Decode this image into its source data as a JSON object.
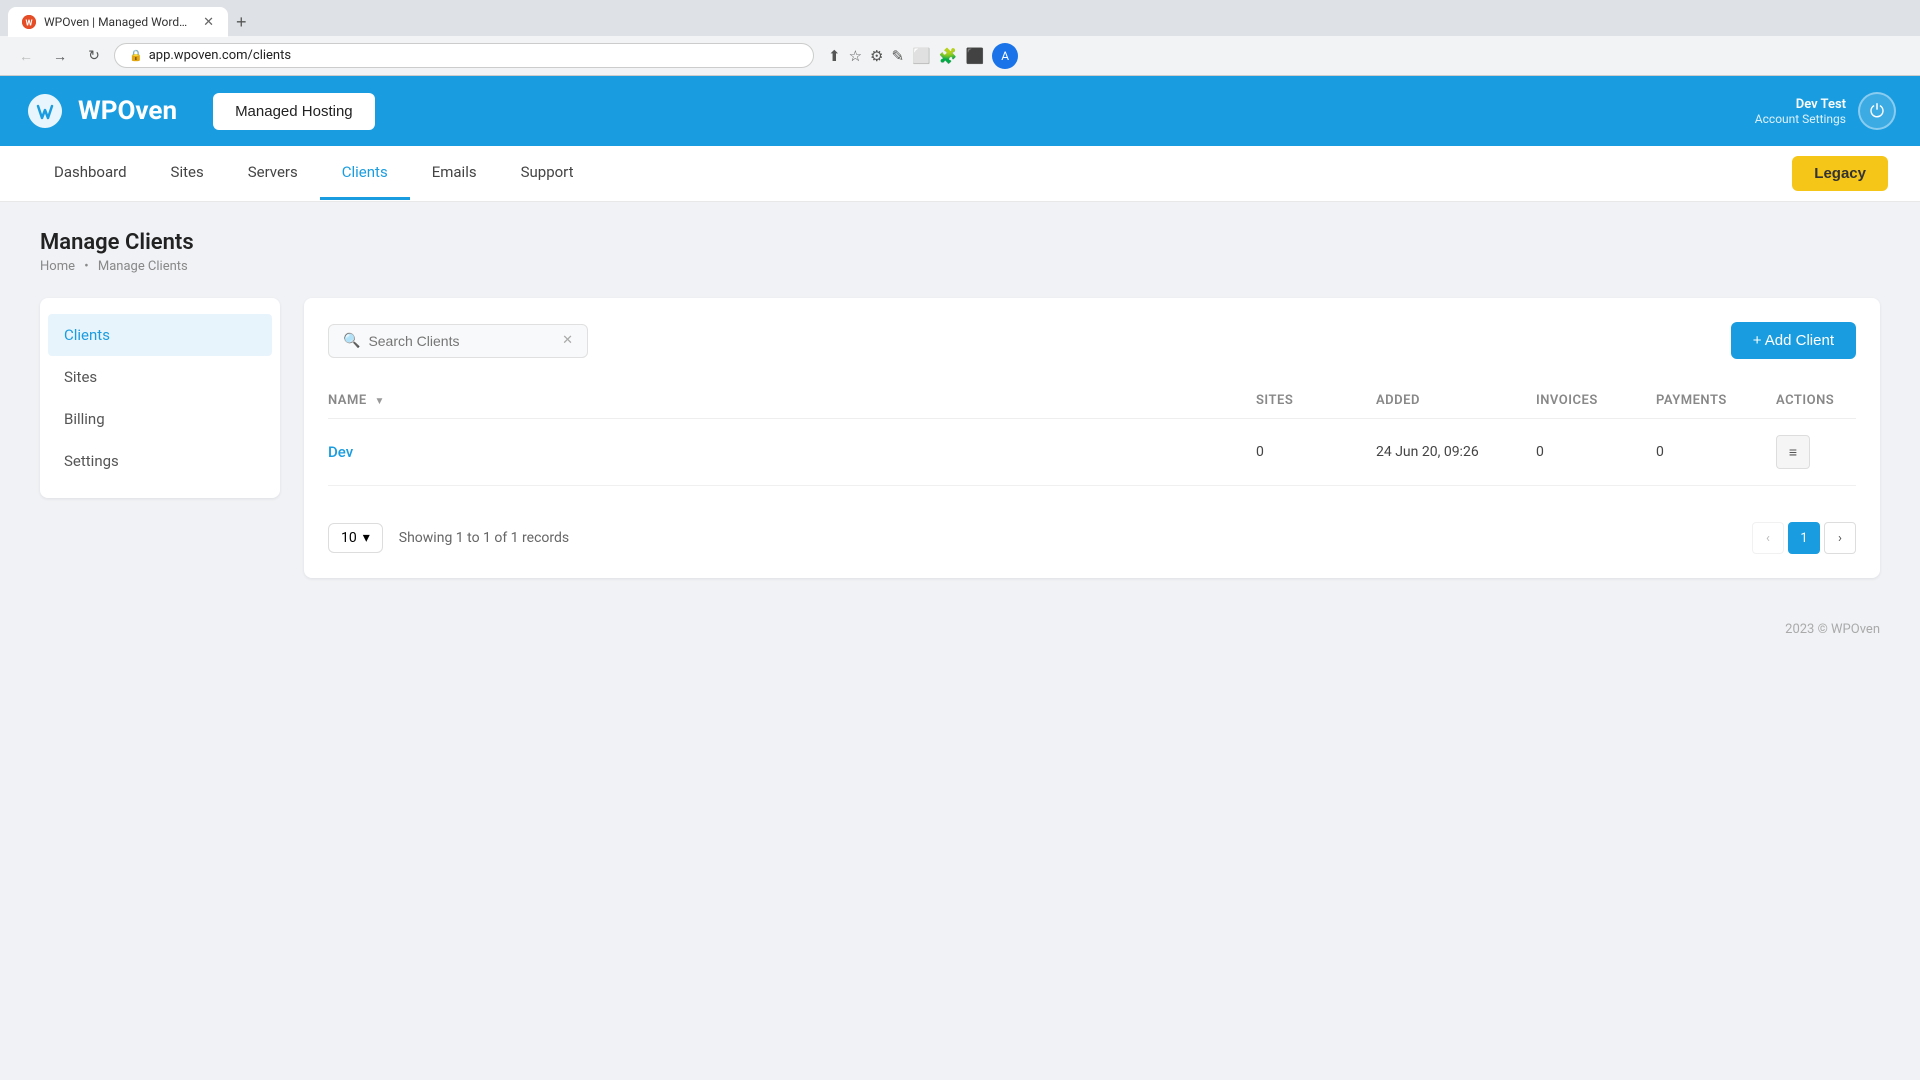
{
  "browser": {
    "tab_title": "WPOven | Managed WordPress ...",
    "tab_favicon": "W",
    "url": "app.wpoven.com/clients",
    "new_tab_label": "+"
  },
  "header": {
    "logo_text": "WPOven",
    "managed_hosting_label": "Managed Hosting",
    "user_name": "Dev Test",
    "user_settings_label": "Account Settings",
    "power_icon": "⏻"
  },
  "nav": {
    "links": [
      {
        "label": "Dashboard",
        "active": false
      },
      {
        "label": "Sites",
        "active": false
      },
      {
        "label": "Servers",
        "active": false
      },
      {
        "label": "Clients",
        "active": true
      },
      {
        "label": "Emails",
        "active": false
      },
      {
        "label": "Support",
        "active": false
      }
    ],
    "legacy_label": "Legacy"
  },
  "page": {
    "title": "Manage Clients",
    "breadcrumb_home": "Home",
    "breadcrumb_current": "Manage Clients"
  },
  "sidebar": {
    "items": [
      {
        "label": "Clients",
        "active": true
      },
      {
        "label": "Sites",
        "active": false
      },
      {
        "label": "Billing",
        "active": false
      },
      {
        "label": "Settings",
        "active": false
      }
    ]
  },
  "search": {
    "placeholder": "Search Clients"
  },
  "add_client_label": "+ Add Client",
  "table": {
    "headers": [
      "NAME",
      "SITES",
      "ADDED",
      "INVOICES",
      "PAYMENTS",
      "ACTIONS"
    ],
    "rows": [
      {
        "name": "Dev",
        "name_href": "#",
        "sites": "0",
        "added": "24 Jun 20, 09:26",
        "invoices": "0",
        "payments": "0"
      }
    ]
  },
  "pagination": {
    "per_page": "10",
    "records_text": "Showing 1 to 1 of 1 records",
    "current_page": "1"
  },
  "footer": {
    "text": "2023 © WPOven"
  }
}
